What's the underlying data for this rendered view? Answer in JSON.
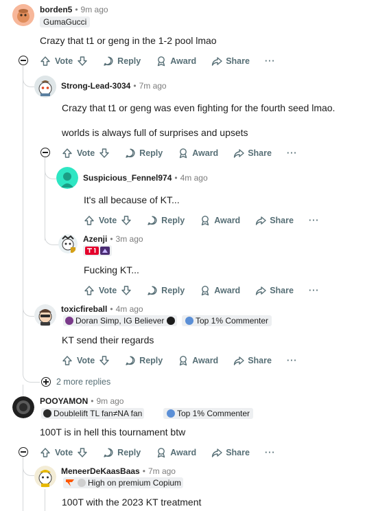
{
  "actions": {
    "vote": "Vote",
    "reply": "Reply",
    "award": "Award",
    "share": "Share",
    "more": "···"
  },
  "comments": [
    {
      "user": "borden5",
      "time": "9m ago",
      "flair": "GumaGucci",
      "text": "Crazy that t1 or geng in the 1-2 pool lmao"
    },
    {
      "user": "Strong-Lead-3034",
      "time": "7m ago",
      "lines": [
        "Crazy that t1 or geng was even fighting for the fourth seed lmao.",
        "worlds is always full of surprises and upsets"
      ]
    },
    {
      "user": "Suspicious_Fennel974",
      "time": "4m ago",
      "text": "It's all because of KT..."
    },
    {
      "user": "Azenji",
      "time": "3m ago",
      "text": "Fucking KT..."
    },
    {
      "user": "toxicfireball",
      "time": "4m ago",
      "flair": "Doran Simp, IG Believer",
      "badge": "Top 1% Commenter",
      "text": "KT send their regards"
    },
    {
      "user": "POOYAMON",
      "time": "9m ago",
      "flair": "Doublelift TL fan≠NA fan",
      "badge": "Top 1% Commenter",
      "text": "100T is in hell this tournament btw"
    },
    {
      "user": "MeneerDeKaasBaas",
      "time": "7m ago",
      "flair": "High on premium Copium",
      "text": "100T with the 2023 KT treatment"
    }
  ],
  "more_replies": "2 more replies",
  "colors": {
    "meta": "#7c7c7c",
    "action": "#576f76",
    "thread_line": "#d4d7d9",
    "flair_bg": "#edeff1"
  }
}
